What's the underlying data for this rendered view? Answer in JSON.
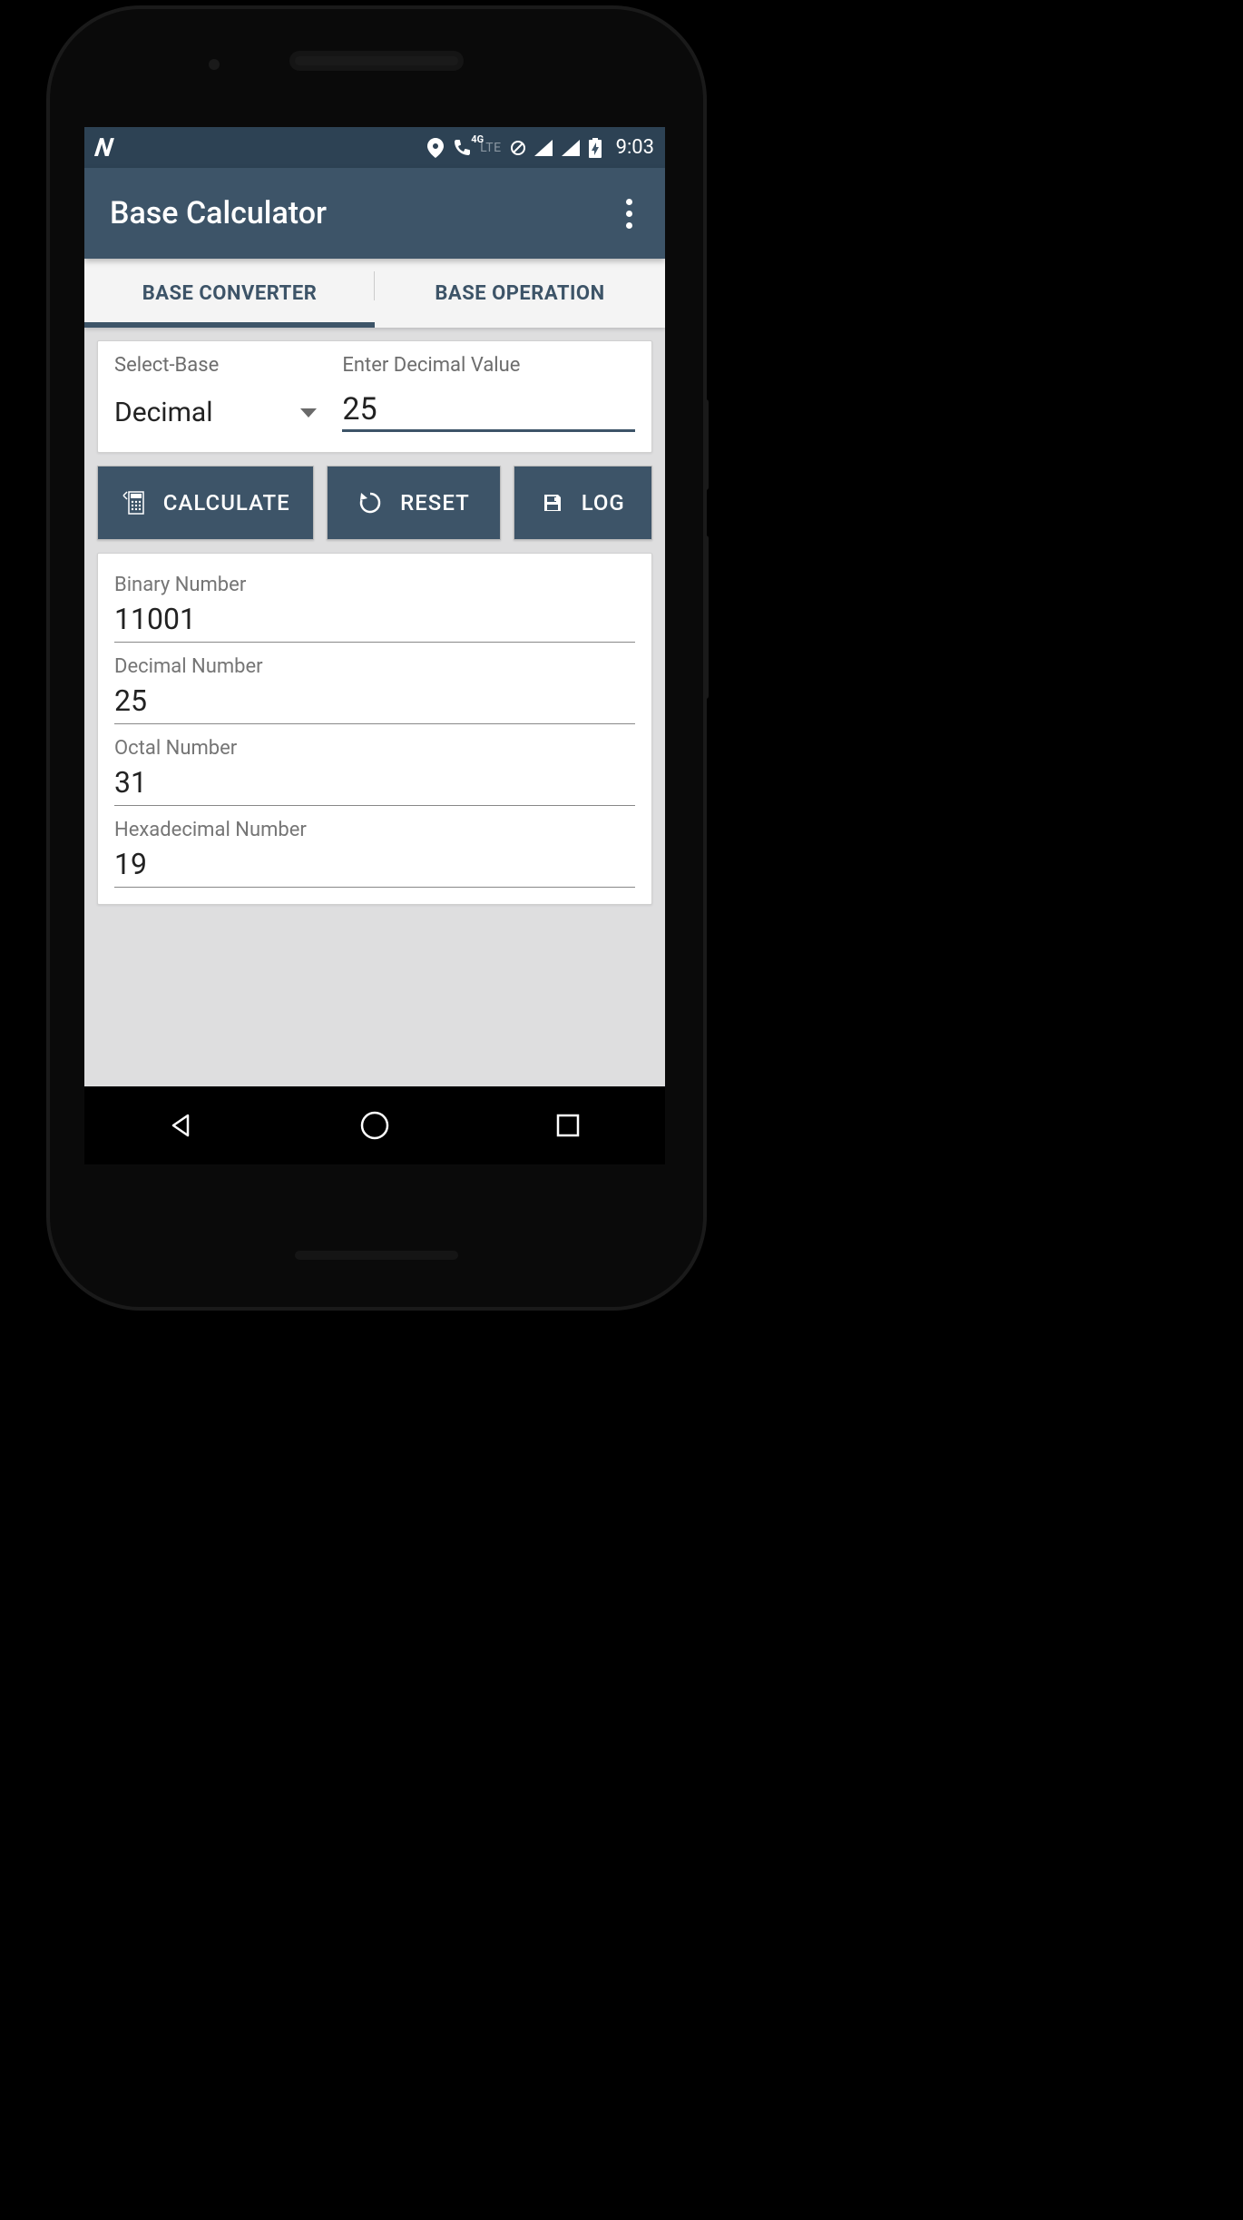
{
  "status": {
    "time": "9:03",
    "lte": "LTE",
    "fourg": "4G"
  },
  "appbar": {
    "title": "Base Calculator"
  },
  "tabs": {
    "converter": "BASE CONVERTER",
    "operation": "BASE OPERATION"
  },
  "input": {
    "select_label": "Select-Base",
    "select_value": "Decimal",
    "value_label": "Enter Decimal Value",
    "value": "25"
  },
  "buttons": {
    "calculate": "CALCULATE",
    "reset": "RESET",
    "log": "LOG"
  },
  "results": {
    "binary_label": "Binary Number",
    "binary_value": "11001",
    "decimal_label": "Decimal Number",
    "decimal_value": "25",
    "octal_label": "Octal Number",
    "octal_value": "31",
    "hex_label": "Hexadecimal Number",
    "hex_value": "19"
  }
}
